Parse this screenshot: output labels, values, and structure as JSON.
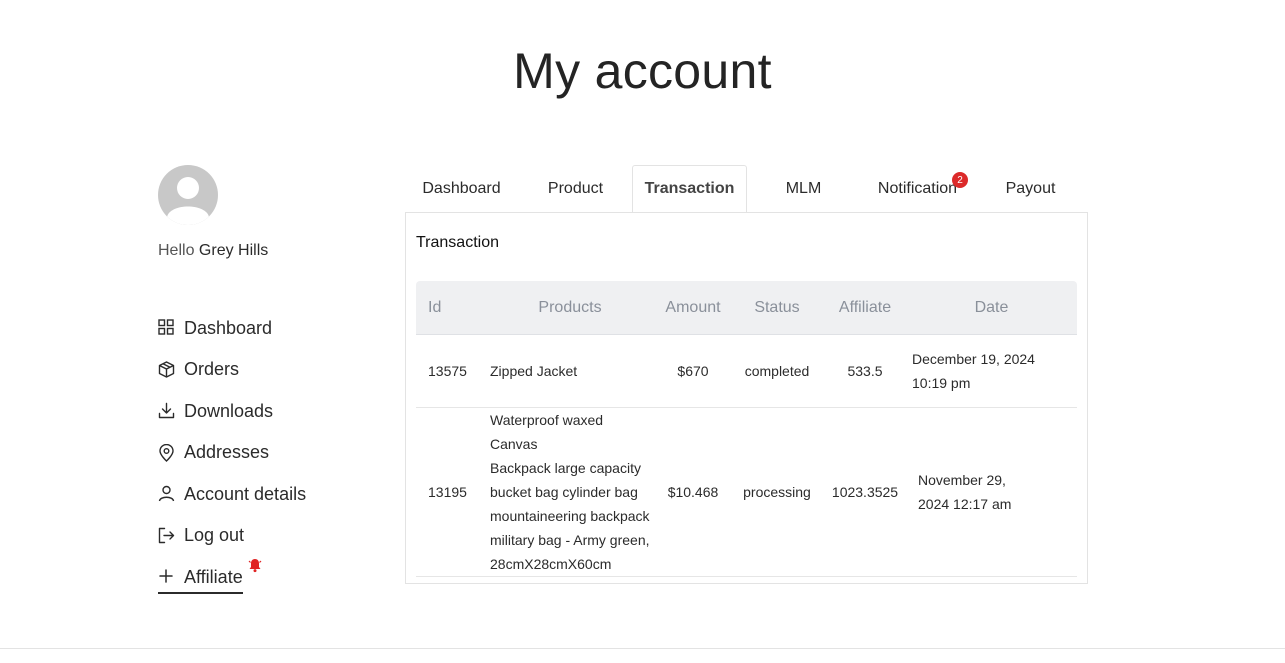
{
  "page": {
    "title": "My account"
  },
  "user": {
    "greeting": "Hello",
    "name": "Grey Hills"
  },
  "sidebar": {
    "items": [
      {
        "label": "Dashboard",
        "icon": "grid-icon"
      },
      {
        "label": "Orders",
        "icon": "box-icon"
      },
      {
        "label": "Downloads",
        "icon": "download-icon"
      },
      {
        "label": "Addresses",
        "icon": "location-pin-icon"
      },
      {
        "label": "Account details",
        "icon": "user-icon"
      },
      {
        "label": "Log out",
        "icon": "logout-icon"
      },
      {
        "label": "Affiliate",
        "icon": "plus-icon",
        "alert_icon": "bell-icon"
      }
    ]
  },
  "tabs": [
    {
      "label": "Dashboard"
    },
    {
      "label": "Product"
    },
    {
      "label": "Transaction",
      "active": true
    },
    {
      "label": "MLM"
    },
    {
      "label": "Notification",
      "badge": "2"
    },
    {
      "label": "Payout"
    }
  ],
  "panel": {
    "title": "Transaction",
    "columns": [
      "Id",
      "Products",
      "Amount",
      "Status",
      "Affiliate",
      "Date"
    ],
    "rows": [
      {
        "id": "13575",
        "product": "Zipped Jacket",
        "amount": "$670",
        "status": "completed",
        "affiliate": "533.5",
        "date_line1": "December 19, 2024",
        "date_line2": "10:19 pm"
      },
      {
        "id": "13195",
        "product_lines": [
          "Waterproof waxed Canvas",
          "Backpack large capacity",
          "bucket bag cylinder bag",
          "mountaineering backpack",
          "military bag - Army green,",
          "28cmX28cmX60cm"
        ],
        "amount": "$10.468",
        "status": "processing",
        "affiliate": "1023.3525",
        "date_line1": "November 29,",
        "date_line2": "2024 12:17 am"
      }
    ]
  },
  "colors": {
    "badge": "#dc2a2a",
    "header_bg": "#eff0f2",
    "avatar": "#c8c8c8"
  }
}
